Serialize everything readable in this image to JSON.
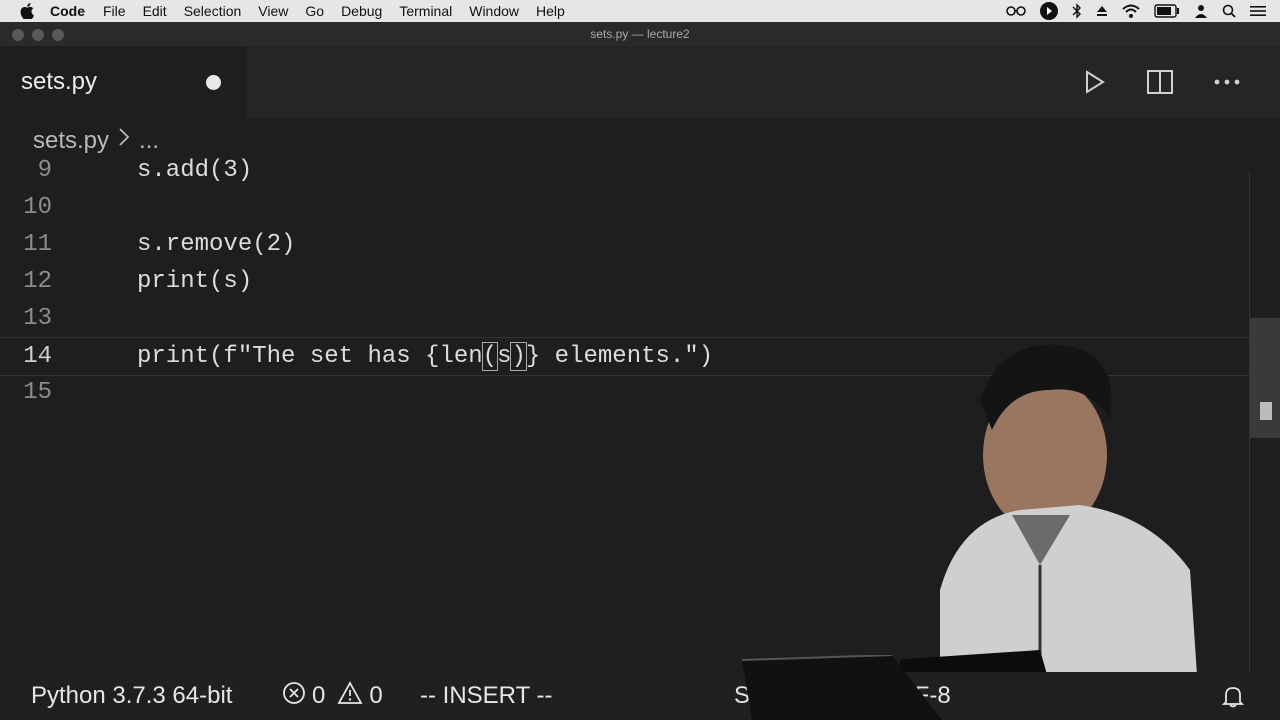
{
  "menubar": {
    "app_name": "Code",
    "items": [
      "File",
      "Edit",
      "Selection",
      "View",
      "Go",
      "Debug",
      "Terminal",
      "Window",
      "Help"
    ],
    "tray_icons": [
      "accessibility-icon",
      "play-circle-icon",
      "bluetooth-icon",
      "eject-icon",
      "wifi-icon",
      "battery-icon",
      "user-icon",
      "search-icon",
      "menu-icon"
    ]
  },
  "window": {
    "title": "sets.py — lecture2"
  },
  "tab": {
    "name": "sets.py",
    "dirty": true
  },
  "actions": [
    "run-icon",
    "split-editor-icon",
    "more-icon"
  ],
  "breadcrumb": {
    "file": "sets.py",
    "rest": "..."
  },
  "editor": {
    "lines": [
      {
        "num": "9",
        "text": "s.add(3)"
      },
      {
        "num": "10",
        "text": ""
      },
      {
        "num": "11",
        "text": "s.remove(2)"
      },
      {
        "num": "12",
        "text": "print(s)"
      },
      {
        "num": "13",
        "text": ""
      },
      {
        "num": "14",
        "pre": "print(f\"The set has {len",
        "b1": "(",
        "mid": "s",
        "b2": ")",
        "post": "} elements.\")"
      },
      {
        "num": "15",
        "text": ""
      }
    ]
  },
  "statusbar": {
    "python": "Python 3.7.3 64-bit",
    "errors": "0",
    "warnings": "0",
    "mode": "-- INSERT --",
    "right_partial_1": "Sp",
    "right_partial_2": "TF-8"
  },
  "colors": {
    "editor_bg": "#1e1e1e",
    "tabbar_bg": "#252526",
    "status_bg": "#202020"
  }
}
